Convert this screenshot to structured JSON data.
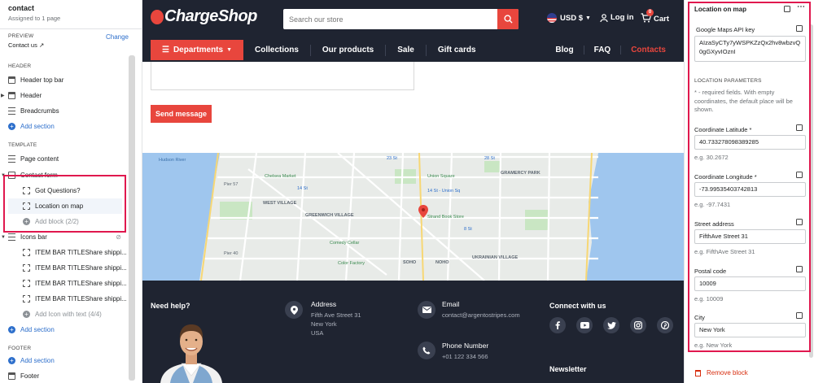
{
  "left_panel": {
    "title": "contact",
    "subtitle": "Assigned to 1 page",
    "preview_caption": "PREVIEW",
    "preview_change": "Change",
    "preview_value": "Contact us",
    "header_caption": "HEADER",
    "header_items": [
      "Header top bar",
      "Header",
      "Breadcrumbs"
    ],
    "add_section": "Add section",
    "template_caption": "TEMPLATE",
    "template_items": [
      "Page content",
      "Contact form"
    ],
    "contact_form_blocks": [
      "Got Questions?",
      "Location on map"
    ],
    "add_block": "Add block (2/2)",
    "icons_bar": "Icons bar",
    "icons_bar_items": [
      "ITEM BAR TITLEShare shippi...",
      "ITEM BAR TITLEShare shippi...",
      "ITEM BAR TITLEShare shippi...",
      "ITEM BAR TITLEShare shippi..."
    ],
    "add_icon": "Add Icon with text (4/4)",
    "footer_caption": "FOOTER",
    "footer_item": "Footer"
  },
  "site": {
    "logo": "ChargeShop",
    "search_placeholder": "Search our store",
    "currency": "USD $",
    "login": "Log in",
    "cart": "Cart",
    "cart_count": "0",
    "departments": "Departments",
    "nav_left": [
      "Collections",
      "Our products",
      "Sale",
      "Gift cards"
    ],
    "nav_right": [
      "Blog",
      "FAQ",
      "Contacts"
    ],
    "send_button": "Send message",
    "map_labels": [
      "Hudson River",
      "WEST VILLAGE",
      "GREENWICH VILLAGE",
      "SOHO",
      "NOHO",
      "UKRAINIAN VILLAGE",
      "GRAMERCY PARK",
      "Union Square",
      "14 St - Union Sq",
      "Comedy Cellar",
      "Strand Book Store",
      "Color Factory",
      "Pier 57",
      "Pier 40",
      "14 St",
      "23 St",
      "28 St",
      "8 St",
      "Chelsea Market"
    ],
    "footer": {
      "need_help": "Need help?",
      "address_label": "Address",
      "address_lines": [
        "Fifth Ave Street 31",
        "New York",
        "USA"
      ],
      "email_label": "Email",
      "email_value": "contact@argentostripes.com",
      "phone_label": "Phone Number",
      "phone_value": "+01 122 334 566",
      "connect": "Connect with us",
      "newsletter": "Newsletter"
    }
  },
  "right_panel": {
    "title": "Location on map",
    "api_label": "Google Maps API key",
    "api_value": "AIzaSyCTy7yWSPKZzQx2hv8wbzvQ0gGXyvIOznI",
    "params_caption": "LOCATION PARAMETERS",
    "params_desc": "* - required fields. With empty coordinates, the default place will be shown.",
    "lat_label": "Coordinate Latitude *",
    "lat_value": "40.733278098389285",
    "lat_hint": "e.g. 30.2672",
    "lng_label": "Coordinate Longitude *",
    "lng_value": "-73.99535403742813",
    "lng_hint": "e.g. -97.7431",
    "street_label": "Street address",
    "street_value": "FifthAve Street 31",
    "street_hint": "e.g. FifthAve Street 31",
    "postal_label": "Postal code",
    "postal_value": "10009",
    "postal_hint": "e.g. 10009",
    "city_label": "City",
    "city_value": "New York",
    "city_hint": "e.g. New York",
    "remove": "Remove block"
  },
  "colors": {
    "accent": "#e8463d",
    "header_bg": "#1f2431",
    "link": "#2c6ecb",
    "highlight": "#e0184e"
  }
}
